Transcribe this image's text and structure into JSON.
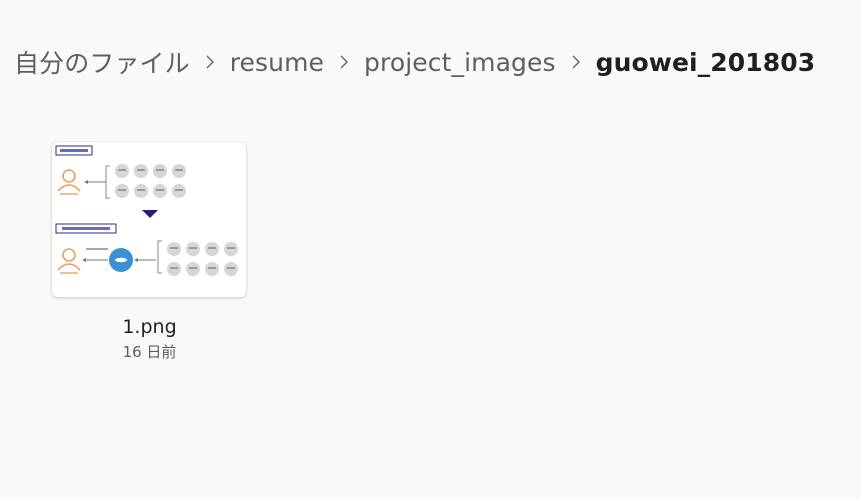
{
  "breadcrumb": {
    "items": [
      "自分のファイル",
      "resume",
      "project_images",
      "guowei_201803"
    ]
  },
  "file": {
    "name": "1.png",
    "modified": "16 日前"
  },
  "icons": {
    "separator": "chevron-right-icon"
  },
  "colors": {
    "background": "#faf9f8",
    "accent_blue": "#3b8fd4",
    "person_orange": "#e8a05a",
    "navy_arrow": "#1f1f7a"
  }
}
